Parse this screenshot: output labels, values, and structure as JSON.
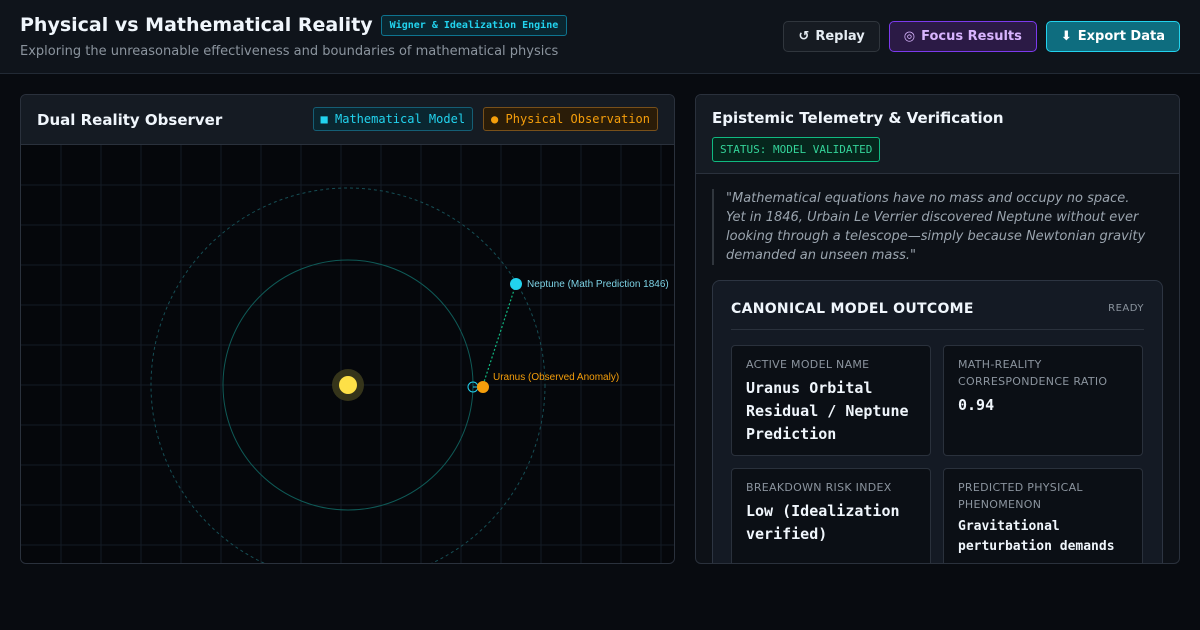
{
  "header": {
    "title": "Physical vs Mathematical Reality",
    "engine_badge": "Wigner & Idealization Engine",
    "subtitle": "Exploring the unreasonable effectiveness and boundaries of mathematical physics",
    "actions": {
      "replay_icon": "↺",
      "replay_label": "Replay",
      "focus_icon": "◎",
      "focus_label": "Focus Results",
      "export_icon": "⬇",
      "export_label": "Export Data"
    }
  },
  "observer": {
    "title": "Dual Reality Observer",
    "legend_math": "■ Mathematical Model",
    "legend_phys": "● Physical Observation",
    "neptune_label": "Neptune (Math Prediction 1846)",
    "uranus_label": "Uranus (Observed Anomaly)"
  },
  "telemetry": {
    "title": "Epistemic Telemetry & Verification",
    "status": "STATUS: MODEL VALIDATED",
    "quote": "\"Mathematical equations have no mass and occupy no space. Yet in 1846, Urbain Le Verrier discovered Neptune without ever looking through a telescope—simply because Newtonian gravity demanded an unseen mass.\"",
    "outcome": {
      "title": "CANONICAL MODEL OUTCOME",
      "state": "READY",
      "cards": [
        {
          "label": "Active Model Name",
          "value": "Uranus Orbital Residual / Neptune Prediction"
        },
        {
          "label": "Math-Reality Correspondence Ratio",
          "value": "0.94"
        },
        {
          "label": "Breakdown Risk Index",
          "value": "Low (Idealization verified)"
        },
        {
          "label": "Predicted Physical Phenomenon",
          "value": "Gravitational perturbation demands"
        }
      ]
    }
  },
  "colors": {
    "math": "#22d3ee",
    "physical": "#f59e0b",
    "sun": "#fde047",
    "validated": "#34d399",
    "focus": "#7c3aed"
  },
  "icons": {
    "replay": "replay-icon",
    "focus": "target-icon",
    "export": "download-icon"
  }
}
